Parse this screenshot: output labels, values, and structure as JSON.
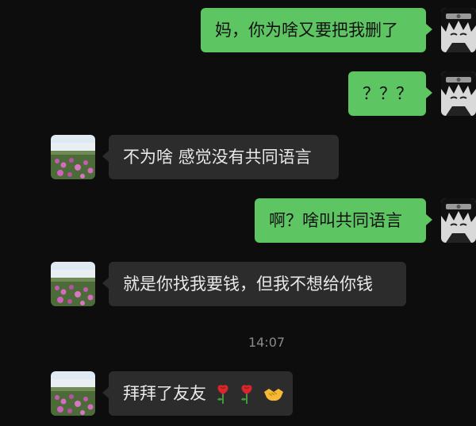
{
  "messages": [
    {
      "side": "right",
      "text": "妈，你为啥又要把我删了"
    },
    {
      "side": "right",
      "text": "？？？"
    },
    {
      "side": "left",
      "text": "不为啥 感觉没有共同语言"
    },
    {
      "side": "right",
      "text": "啊？啥叫共同语言"
    },
    {
      "side": "left",
      "text": "就是你找我要钱，但我不想给你钱"
    },
    {
      "side": "left",
      "text": "拜拜了友友"
    }
  ],
  "timestamp": "14:07",
  "last_message_emojis": [
    "rose-emoji",
    "rose-emoji",
    "handshake-emoji"
  ],
  "colors": {
    "background": "#0d0d0d",
    "outgoing_bubble": "#5ec563",
    "incoming_bubble": "#2c2c2c",
    "timestamp_text": "#8a8a8a"
  }
}
